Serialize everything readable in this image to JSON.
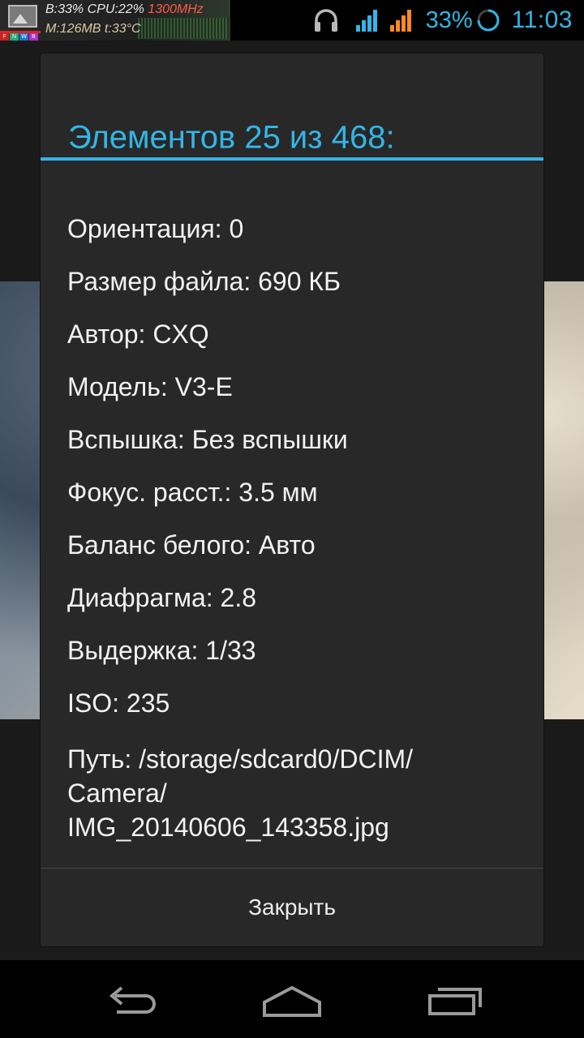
{
  "status_bar": {
    "sysmon_line1_prefix": "B:33% CPU:22%",
    "sysmon_line1_freq": "1300MHz",
    "sysmon_line2": "M:126MB t:33°C",
    "sysmon_flags": [
      "F",
      "N",
      "W",
      "B"
    ],
    "battery_percent": "33%",
    "time": "11:03",
    "accent_color": "#33b5e5",
    "icons": [
      "picture-icon",
      "headphones-icon",
      "signal-icon",
      "signal-icon",
      "battery-icon"
    ]
  },
  "dialog": {
    "title": "Элементов 25 из 468:",
    "rows": [
      "Ориентация: 0",
      "Размер файла: 690 КБ",
      "Автор: CXQ",
      "Модель: V3-E",
      "Вспышка: Без вспышки",
      "Фокус. расст.: 3.5 мм",
      "Баланс белого: Авто",
      "Диафрагма: 2.8",
      "Выдержка: 1/33",
      "ISO: 235"
    ],
    "path_lines": [
      "Путь: /storage/sdcard0/DCIM/",
      "Camera/",
      "IMG_20140606_143358.jpg"
    ],
    "close_label": "Закрыть"
  },
  "nav_bar": {
    "icons": [
      "back-icon",
      "home-icon",
      "recent-apps-icon"
    ]
  }
}
